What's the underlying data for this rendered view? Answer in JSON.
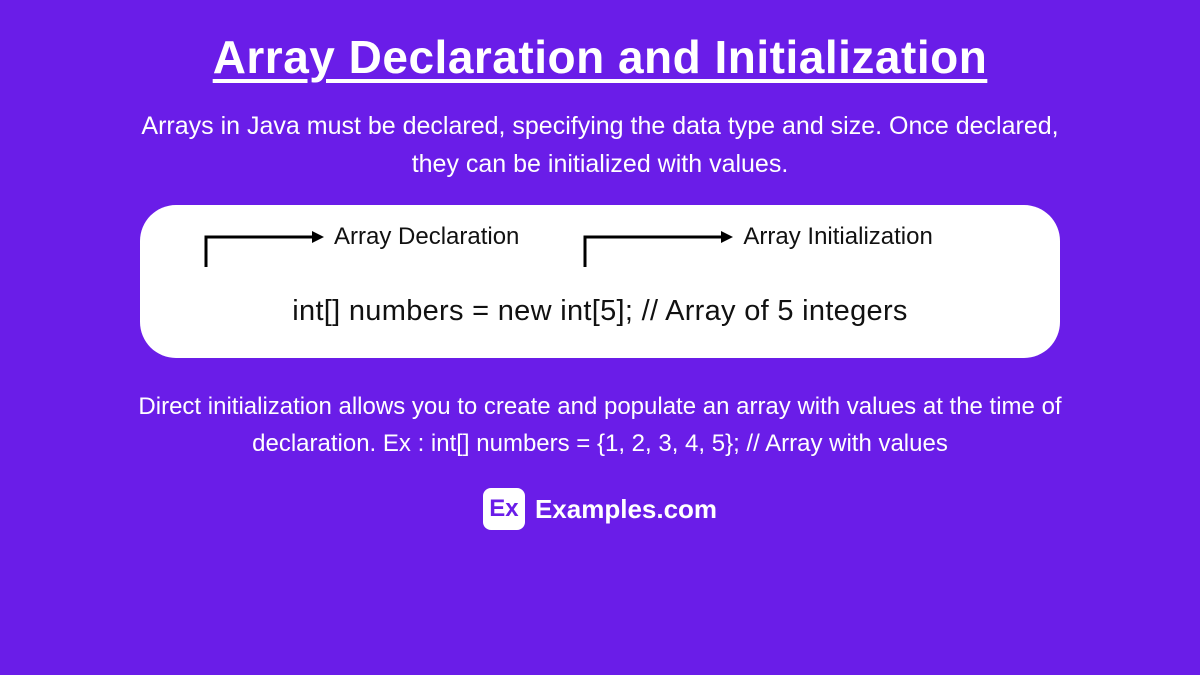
{
  "title": "Array Declaration and Initialization",
  "description": "Arrays in Java must be declared, specifying the data type and size. Once declared, they can be initialized with values.",
  "code_box": {
    "annotation_left": "Array Declaration",
    "annotation_right": "Array Initialization",
    "code": "int[] numbers = new int[5]; // Array of 5 integers"
  },
  "footer": "Direct initialization allows you to create and populate an array with values at the time of declaration. Ex : int[] numbers = {1, 2, 3, 4, 5}; // Array with values",
  "brand": {
    "icon_text": "Ex",
    "name": "Examples.com"
  }
}
